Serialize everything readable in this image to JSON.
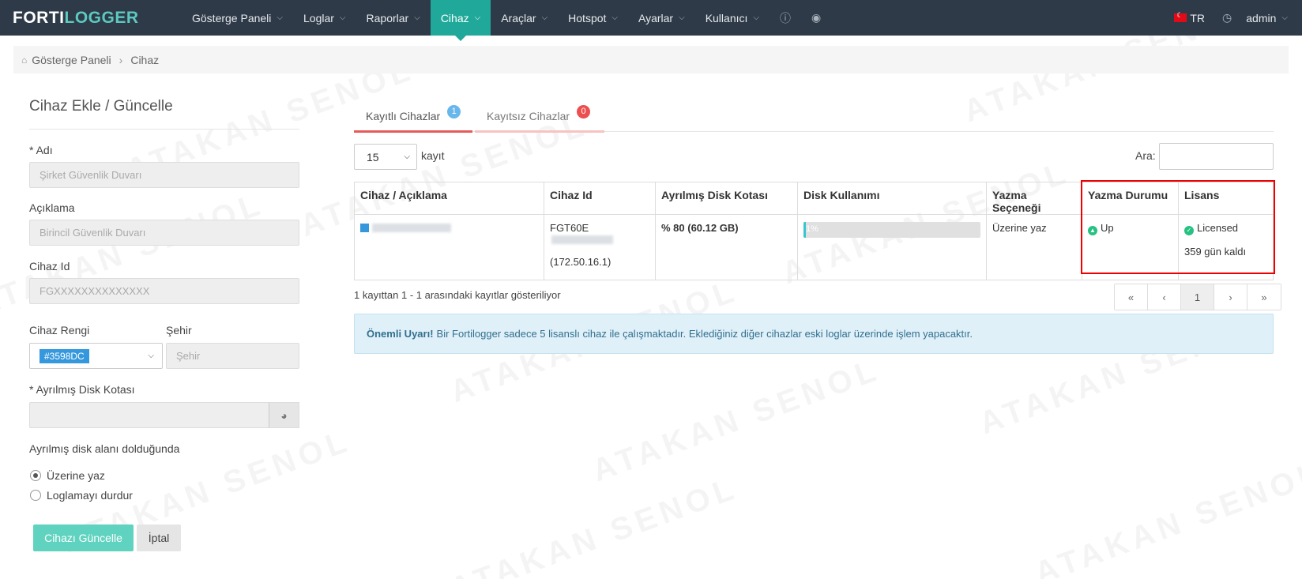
{
  "brand": {
    "part1": "FORTI",
    "part2": "LOGGER"
  },
  "nav": {
    "items": [
      {
        "label": "Gösterge Paneli",
        "active": false
      },
      {
        "label": "Loglar",
        "active": false
      },
      {
        "label": "Raporlar",
        "active": false
      },
      {
        "label": "Cihaz",
        "active": true
      },
      {
        "label": "Araçlar",
        "active": false
      },
      {
        "label": "Hotspot",
        "active": false
      },
      {
        "label": "Ayarlar",
        "active": false
      },
      {
        "label": "Kullanıcı",
        "active": false
      }
    ],
    "info_icon": "ⓘ",
    "eye_icon": "◉",
    "lang": "TR",
    "clock_icon": "◷",
    "user": "admin"
  },
  "breadcrumb": {
    "home": "Gösterge Paneli",
    "current": "Cihaz"
  },
  "form": {
    "title": "Cihaz Ekle / Güncelle",
    "name_label": "* Adı",
    "name_placeholder": "Şirket Güvenlik Duvarı",
    "desc_label": "Açıklama",
    "desc_placeholder": "Birincil Güvenlik Duvarı",
    "id_label": "Cihaz Id",
    "id_placeholder": "FGXXXXXXXXXXXXXX",
    "color_label": "Cihaz Rengi",
    "color_value": "#3598DC",
    "city_label": "Şehir",
    "city_placeholder": "Şehir",
    "quota_label": "* Ayrılmış Disk Kotası",
    "full_label": "Ayrılmış disk alanı dolduğunda",
    "option_overwrite": "Üzerine yaz",
    "option_stop": "Loglamayı durdur",
    "update_button": "Cihazı Güncelle",
    "cancel_button": "İptal"
  },
  "tabs": [
    {
      "label": "Kayıtlı Cihazlar",
      "count": "1"
    },
    {
      "label": "Kayıtsız Cihazlar",
      "count": "0"
    }
  ],
  "table_controls": {
    "page_length": "15",
    "length_suffix": "kayıt",
    "search_label": "Ara:"
  },
  "table": {
    "headers": [
      "Cihaz / Açıklama",
      "Cihaz Id",
      "Ayrılmış Disk Kotası",
      "Disk Kullanımı",
      "Yazma Seçeneği",
      "Yazma Durumu",
      "Lisans"
    ],
    "row": {
      "device_id_prefix": "FGT60E",
      "ip": "(172.50.16.1)",
      "quota": "% 80 (60.12 GB)",
      "disk_usage_text": "1%",
      "disk_usage_fraction": 0.01,
      "write_option": "Üzerine yaz",
      "write_status": "Up",
      "license": "Licensed",
      "license_days": "359 gün kaldı"
    }
  },
  "table_info": "1 kayıttan 1 - 1 arasındaki kayıtlar gösteriliyor",
  "pagination": [
    "«",
    "‹",
    "1",
    "›",
    "»"
  ],
  "alert": {
    "title": "Önemli Uyarı!",
    "text": "Bir Fortilogger sadece 5 lisanslı cihaz ile çalışmaktadır. Eklediğiniz diğer cihazlar eski loglar üzerinde işlem yapacaktır."
  },
  "watermark": "ATAKAN SENOL"
}
